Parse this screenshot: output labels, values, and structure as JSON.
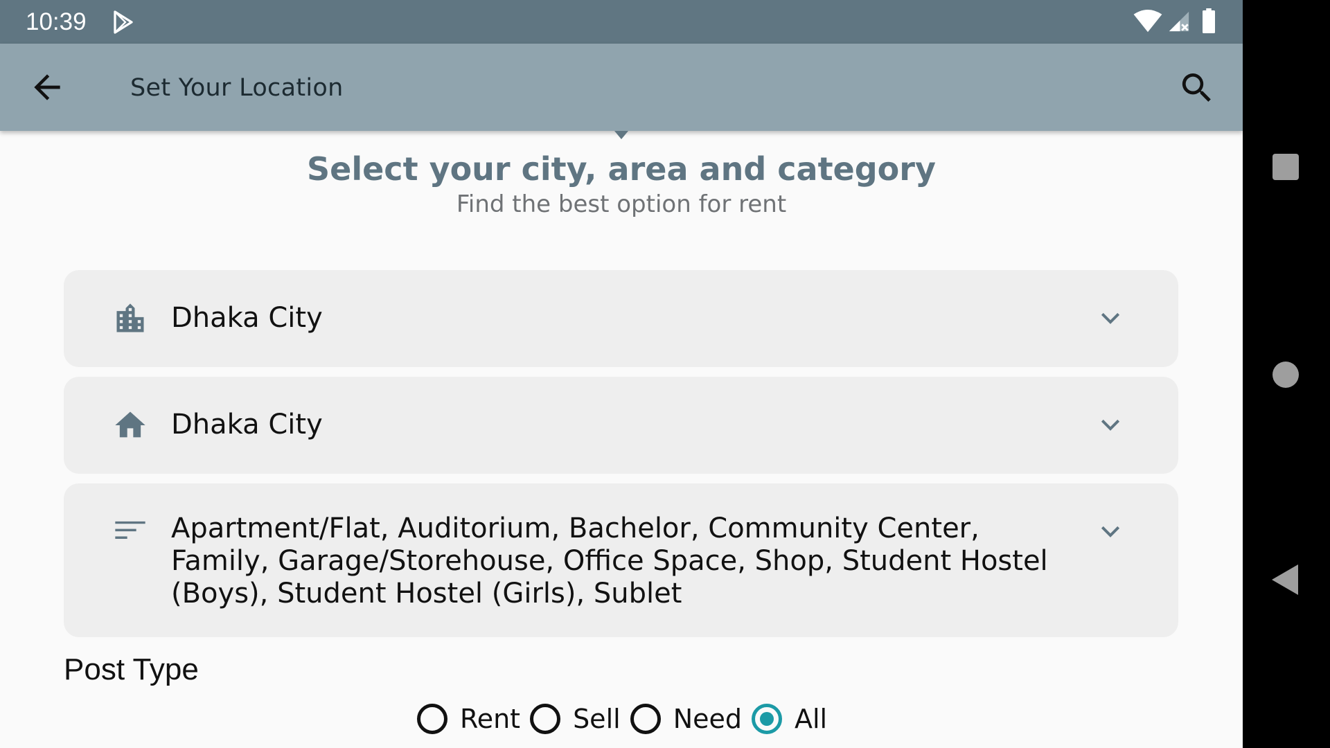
{
  "status_bar": {
    "time": "10:39",
    "icons": [
      "play-store-icon",
      "wifi-icon",
      "signal-icon",
      "battery-icon"
    ]
  },
  "app_bar": {
    "title": "Set Your Location",
    "back_icon": "arrow-left-icon",
    "search_icon": "search-icon",
    "background": "#90a4ae"
  },
  "header": {
    "title": "Select your city, area and category",
    "subtitle": "Find the best option for rent"
  },
  "selectors": {
    "city": {
      "icon": "city-buildings-icon",
      "value": "Dhaka City"
    },
    "area": {
      "icon": "home-icon",
      "value": "Dhaka City"
    },
    "category": {
      "icon": "filter-list-icon",
      "value": "Apartment/Flat, Auditorium, Bachelor, Community Center, Family, Garage/Storehouse, Office Space, Shop, Student Hostel (Boys), Student Hostel (Girls), Sublet"
    }
  },
  "post_type": {
    "label": "Post Type",
    "options": [
      {
        "label": "Rent",
        "checked": false
      },
      {
        "label": "Sell",
        "checked": false
      },
      {
        "label": "Need",
        "checked": false
      },
      {
        "label": "All",
        "checked": true
      }
    ],
    "accent": "#1c9aa6"
  },
  "nav_bar": {
    "buttons": [
      "recents-icon",
      "home-circle-icon",
      "back-triangle-icon"
    ]
  }
}
